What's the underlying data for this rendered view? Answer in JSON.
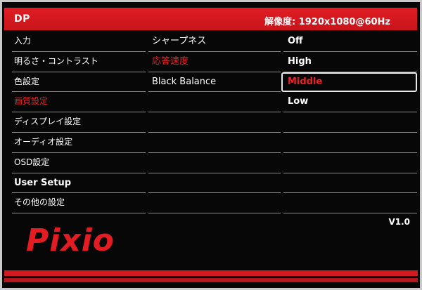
{
  "header": {
    "input_source": "DP",
    "resolution": "解像度: 1920x1080@60Hz"
  },
  "main_menu": [
    {
      "label": "入力"
    },
    {
      "label": "明るさ・コントラスト"
    },
    {
      "label": "色設定"
    },
    {
      "label": "画質設定",
      "active": true
    },
    {
      "label": "ディスプレイ設定"
    },
    {
      "label": "オーディオ設定"
    },
    {
      "label": "OSD設定"
    },
    {
      "label": "User Setup"
    },
    {
      "label": "その他の設定"
    }
  ],
  "submenu": [
    {
      "label": "シャープネス"
    },
    {
      "label": "応答速度",
      "active": true
    },
    {
      "label": "Black Balance"
    },
    {
      "label": ""
    },
    {
      "label": ""
    },
    {
      "label": ""
    },
    {
      "label": ""
    },
    {
      "label": ""
    },
    {
      "label": ""
    }
  ],
  "options": [
    {
      "label": "Off"
    },
    {
      "label": "High"
    },
    {
      "label": "Middle",
      "selected": true
    },
    {
      "label": "Low"
    },
    {
      "label": ""
    },
    {
      "label": ""
    },
    {
      "label": ""
    },
    {
      "label": ""
    },
    {
      "label": ""
    }
  ],
  "version": "V1.0",
  "brand": "Pixio",
  "colors": {
    "accent": "#e31b22",
    "background": "#070707",
    "text": "#ffffff"
  }
}
